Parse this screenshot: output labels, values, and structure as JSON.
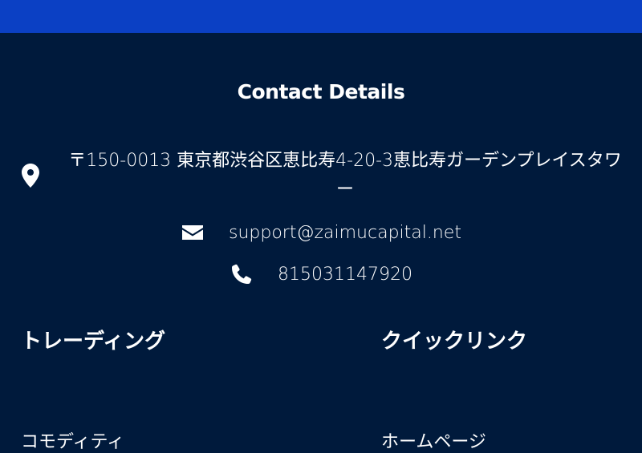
{
  "colors": {
    "top_bar": "#0b40c4",
    "footer_bg": "#001a3c",
    "text": "#ffffff"
  },
  "contact": {
    "title": "Contact Details",
    "address": "〒150-0013 東京都渋谷区恵比寿4-20-3恵比寿ガーデンプレイスタワー",
    "address_icon": "map-marker-icon",
    "email": "support@zaimucapital.net",
    "email_icon": "envelope-icon",
    "phone": "815031147920",
    "phone_icon": "phone-icon"
  },
  "columns": {
    "trading": {
      "title": "トレーディング",
      "first_link": "コモディティ"
    },
    "quick_links": {
      "title": "クイックリンク",
      "first_link": "ホームページ"
    }
  }
}
